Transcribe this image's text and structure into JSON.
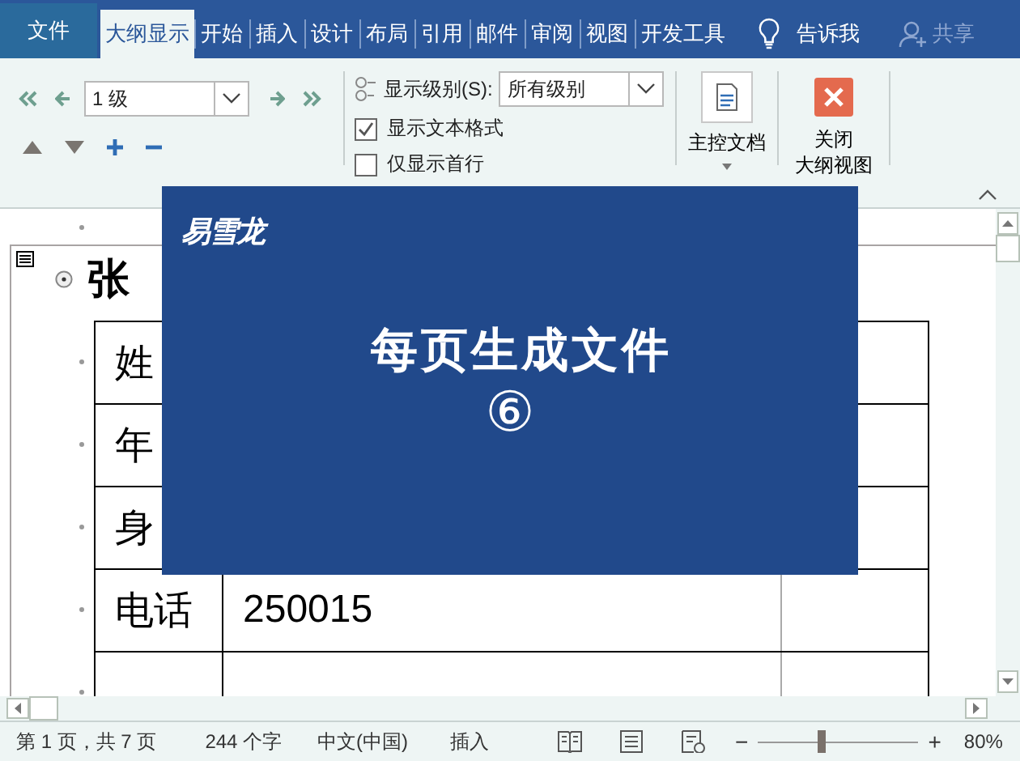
{
  "tabs": [
    {
      "label": "文件",
      "kind": "file",
      "selected": false
    },
    {
      "label": "大纲显示",
      "kind": "tab",
      "selected": true
    },
    {
      "label": "开始",
      "kind": "tab",
      "selected": false
    },
    {
      "label": "插入",
      "kind": "tab",
      "selected": false
    },
    {
      "label": "设计",
      "kind": "tab",
      "selected": false
    },
    {
      "label": "布局",
      "kind": "tab",
      "selected": false
    },
    {
      "label": "引用",
      "kind": "tab",
      "selected": false
    },
    {
      "label": "邮件",
      "kind": "tab",
      "selected": false
    },
    {
      "label": "审阅",
      "kind": "tab",
      "selected": false
    },
    {
      "label": "视图",
      "kind": "tab",
      "selected": false
    },
    {
      "label": "开发工具",
      "kind": "tab",
      "selected": false
    }
  ],
  "tell_me": "告诉我",
  "share": "共享",
  "ribbon": {
    "outline_level": "1 级",
    "show_level_label": "显示级别(S):",
    "show_level_value": "所有级别",
    "options": [
      {
        "label": "显示文本格式",
        "checked": true
      },
      {
        "label": "仅显示首行",
        "checked": false
      }
    ],
    "master_document": "主控文档",
    "close_button": [
      "关闭",
      "大纲视图"
    ]
  },
  "document": {
    "heading": "张",
    "rows": [
      [
        "姓"
      ],
      [
        "年"
      ],
      [
        "身"
      ],
      [
        "电话",
        "250015"
      ]
    ]
  },
  "overlay": {
    "logo": "易雪龙",
    "title": "每页生成文件",
    "number": "⑥"
  },
  "status_bar": {
    "page": "第 1 页，共 7 页",
    "words": "244 个字",
    "language": "中文(中国)",
    "mode": "插入",
    "zoom_minus": "−",
    "zoom_plus": "+",
    "zoom": "80%",
    "zoom_slider": {
      "level": 0.39
    }
  }
}
